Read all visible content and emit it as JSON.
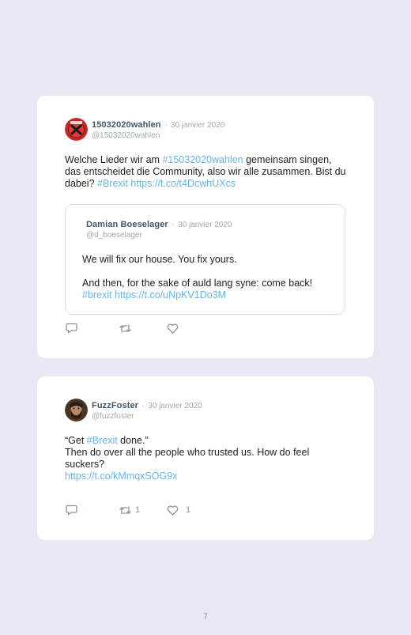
{
  "tweets": [
    {
      "name": "15032020wahlen",
      "dot": "·",
      "date": "30 janvier 2020",
      "handle": "@15032020wahlen",
      "text": {
        "t1": "Welche Lieder wir am ",
        "l1": "#15032020wahlen",
        "t2": " gemeinsam singen, das entscheidet die Community, also wir alle zusammen. Bist du dabei? ",
        "l2": "#Brexit",
        "t3": " ",
        "l3": "https://t.co/t4DcwhUXcs"
      },
      "quote": {
        "name": "Damian Boeselager",
        "dot": "·",
        "date": "30 janvier 2020",
        "handle": "@d_boeselager",
        "line1": "We will fix our house. You fix yours.",
        "line2": "And then, for the sake of auld lang syne: come back!",
        "l1": "#brexit",
        "l2": "https://t.co/uNpKV1Do3M"
      },
      "actions": {
        "retweets": "",
        "likes": ""
      },
      "colors": {
        "avatar_bg": "#c62828"
      }
    },
    {
      "name": "FuzzFoster",
      "dot": "·",
      "date": "30 janvier 2020",
      "handle": "@fuzzfoster",
      "text": {
        "t1": "“Get ",
        "l1": "#Brexit",
        "t2": " done.”",
        "t3": "Then do over all the people who trusted us. How do feel suckers?",
        "l2": "https://t.co/kMmqxSOG9x"
      },
      "actions": {
        "retweets": "1",
        "likes": "1"
      },
      "colors": {
        "avatar_bg": "#4a3426"
      }
    }
  ],
  "icons": [
    "reply-icon",
    "retweet-icon",
    "like-icon"
  ],
  "colors": {
    "link": "#66b6e6",
    "background": "#e8e9f3",
    "card": "#ffffff"
  },
  "page_number": "7"
}
